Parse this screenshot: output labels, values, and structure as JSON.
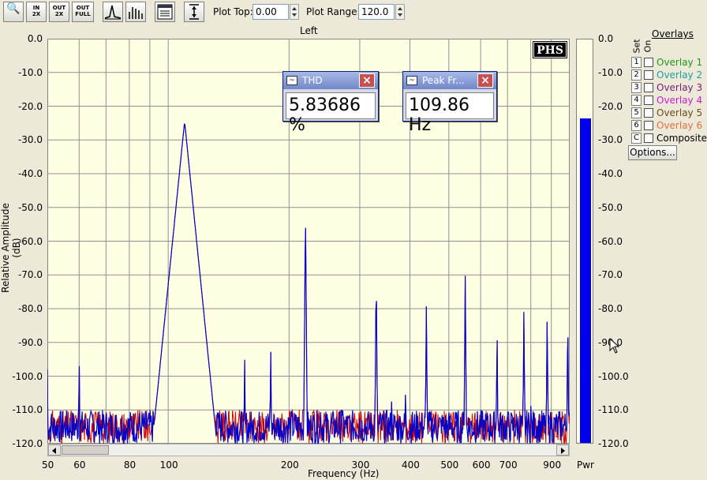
{
  "toolbar": {
    "zoom_in_2x": "IN\n2X",
    "zoom_out_2x": "OUT\n2X",
    "zoom_out_full": "OUT\nFULL",
    "plot_top_label": "Plot Top:",
    "plot_top_value": "0.00",
    "plot_range_label": "Plot Range:",
    "plot_range_value": "120.0"
  },
  "plot": {
    "title": "Left",
    "ylabel": "Relative Amplitude (dB)",
    "xlabel": "Frequency (Hz)",
    "logo": "PHS"
  },
  "readouts": {
    "thd": {
      "title": "THD",
      "value": "5.83686 %"
    },
    "peak": {
      "title": "Peak Fr...",
      "value": "109.86 Hz"
    }
  },
  "power": {
    "label": "Pwr",
    "level_db": -23.5
  },
  "overlays": {
    "title": "Overlays",
    "set_header": "Set",
    "on_header": "On",
    "items": [
      {
        "num": "1",
        "label": "Overlay 1",
        "color": "#1a9a1a"
      },
      {
        "num": "2",
        "label": "Overlay 2",
        "color": "#1aa0a0"
      },
      {
        "num": "3",
        "label": "Overlay 3",
        "color": "#7a1a7a"
      },
      {
        "num": "4",
        "label": "Overlay 4",
        "color": "#d01ad0"
      },
      {
        "num": "5",
        "label": "Overlay 5",
        "color": "#6a4a1a"
      },
      {
        "num": "6",
        "label": "Overlay 6",
        "color": "#e07040"
      },
      {
        "num": "C",
        "label": "Composite",
        "color": "#000000"
      }
    ],
    "options_label": "Options..."
  },
  "chart_data": {
    "type": "line",
    "title": "Left",
    "xlabel": "Frequency (Hz)",
    "ylabel": "Relative Amplitude (dB)",
    "xscale": "log",
    "xlim": [
      50,
      1000
    ],
    "ylim": [
      -120,
      0
    ],
    "grid": true,
    "yticks": [
      "0.0",
      "-10.0",
      "-20.0",
      "-30.0",
      "-40.0",
      "-50.0",
      "-60.0",
      "-70.0",
      "-80.0",
      "-90.0",
      "-100.0",
      "-110.0",
      "-120.0"
    ],
    "xticks": [
      {
        "v": 50,
        "label": "50"
      },
      {
        "v": 60,
        "label": "60"
      },
      {
        "v": 80,
        "label": "80"
      },
      {
        "v": 100,
        "label": "100"
      },
      {
        "v": 200,
        "label": "200"
      },
      {
        "v": 300,
        "label": "300"
      },
      {
        "v": 400,
        "label": "400"
      },
      {
        "v": 500,
        "label": "500"
      },
      {
        "v": 600,
        "label": "600"
      },
      {
        "v": 700,
        "label": "700"
      },
      {
        "v": 900,
        "label": "900"
      }
    ],
    "series_colors": {
      "primary": "#0000cc",
      "secondary": "#cc0000"
    },
    "peaks": [
      {
        "f": 50,
        "db": -98
      },
      {
        "f": 60,
        "db": -92
      },
      {
        "f": 109.86,
        "db": -24.5
      },
      {
        "f": 120,
        "db": -103
      },
      {
        "f": 155,
        "db": -93
      },
      {
        "f": 180,
        "db": -89
      },
      {
        "f": 219.7,
        "db": -49.5
      },
      {
        "f": 240,
        "db": -105
      },
      {
        "f": 270,
        "db": -102
      },
      {
        "f": 300,
        "db": -106
      },
      {
        "f": 329.6,
        "db": -68
      },
      {
        "f": 360,
        "db": -106
      },
      {
        "f": 390,
        "db": -103
      },
      {
        "f": 420,
        "db": -110
      },
      {
        "f": 439.5,
        "db": -79
      },
      {
        "f": 480,
        "db": -106
      },
      {
        "f": 500,
        "db": -106
      },
      {
        "f": 549.3,
        "db": -70
      },
      {
        "f": 600,
        "db": -106
      },
      {
        "f": 659.2,
        "db": -85
      },
      {
        "f": 700,
        "db": -108
      },
      {
        "f": 720,
        "db": -106
      },
      {
        "f": 769,
        "db": -79
      },
      {
        "f": 800,
        "db": -108
      },
      {
        "f": 820,
        "db": -110
      },
      {
        "f": 878.9,
        "db": -79
      },
      {
        "f": 900,
        "db": -108
      },
      {
        "f": 960,
        "db": -110
      },
      {
        "f": 988.8,
        "db": -80
      }
    ],
    "noise_floor_db": -115
  }
}
